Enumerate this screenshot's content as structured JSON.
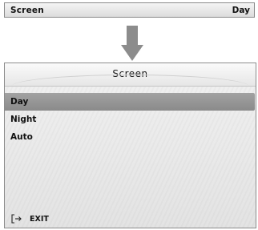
{
  "top_bar": {
    "label": "Screen",
    "value": "Day"
  },
  "panel": {
    "title": "Screen",
    "items": [
      {
        "label": "Day",
        "selected": true
      },
      {
        "label": "Night",
        "selected": false
      },
      {
        "label": "Auto",
        "selected": false
      }
    ],
    "exit_label": "EXIT"
  },
  "icons": {
    "arrow": "down-arrow-icon",
    "exit": "exit-icon"
  },
  "colors": {
    "selected_bg": "#969696",
    "arrow": "#8c8c8c"
  }
}
